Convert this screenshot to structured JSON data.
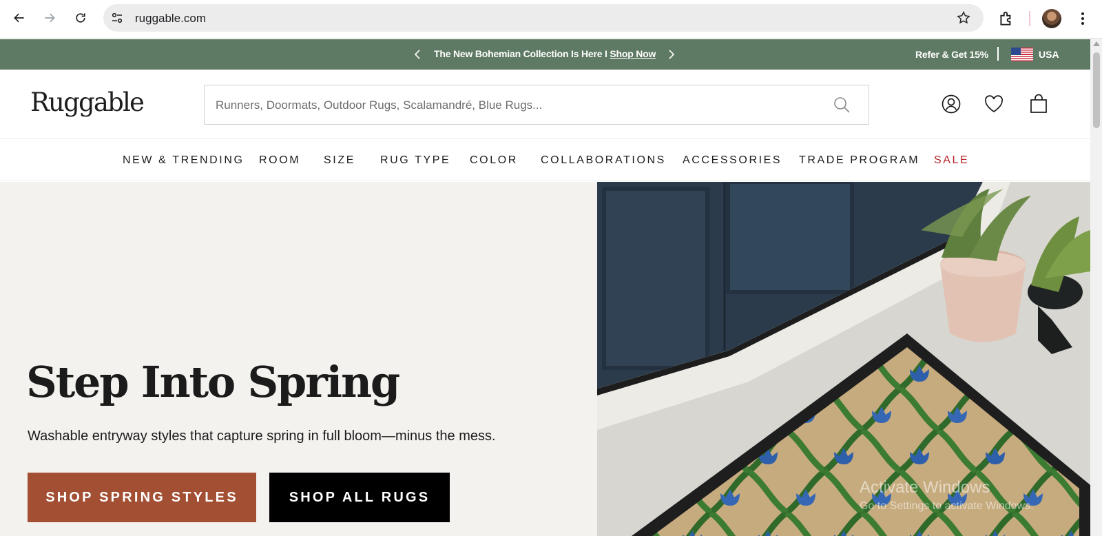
{
  "browser": {
    "url": "ruggable.com",
    "icons": [
      "back-arrow-icon",
      "forward-arrow-icon",
      "reload-icon",
      "site-settings-icon",
      "bookmark-star-icon",
      "extensions-icon",
      "profile-avatar",
      "more-menu-icon"
    ]
  },
  "announcement": {
    "message": "The New Bohemian Collection Is Here I ",
    "link": "Shop Now",
    "refer": "Refer & Get 15%",
    "country": "USA",
    "bg_color": "#5f7a64"
  },
  "header": {
    "logo": "Ruggable",
    "search_placeholder": "Runners, Doormats, Outdoor Rugs, Scalamandré, Blue Rugs..."
  },
  "nav": {
    "items": [
      "NEW & TRENDING",
      "ROOM",
      "SIZE",
      "RUG TYPE",
      "COLOR",
      "COLLABORATIONS",
      "ACCESSORIES",
      "TRADE PROGRAM",
      "SALE"
    ],
    "sale_color": "#b5252a"
  },
  "hero": {
    "title": "Step Into Spring",
    "subtitle": "Washable entryway styles that capture spring in full bloom—minus the mess.",
    "primary_button": "SHOP SPRING STYLES",
    "secondary_button": "SHOP ALL RUGS",
    "primary_color": "#a34f33"
  },
  "watermark": {
    "title": "Activate Windows",
    "subtitle": "Go to Settings to activate Windows."
  }
}
